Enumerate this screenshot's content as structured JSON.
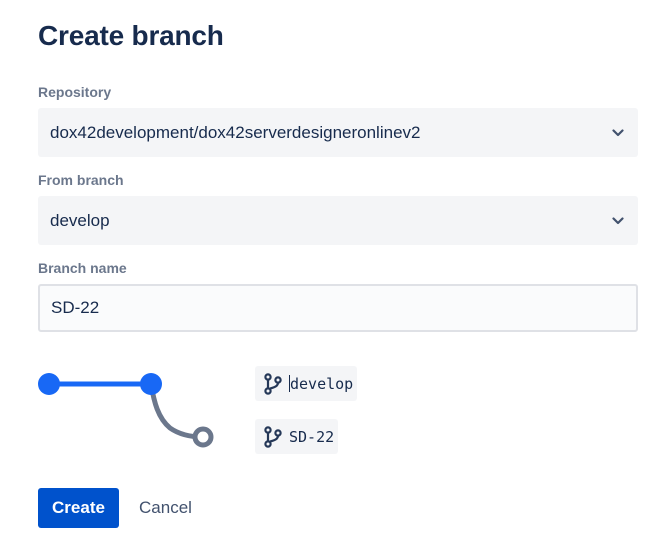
{
  "dialog": {
    "title": "Create branch"
  },
  "repository": {
    "label": "Repository",
    "value": "dox42development/dox42serverdesigneronlinev2"
  },
  "from_branch": {
    "label": "From branch",
    "value": "develop"
  },
  "branch_name": {
    "label": "Branch name",
    "value": "SD-22"
  },
  "preview": {
    "source_branch": "develop",
    "new_branch": "SD-22",
    "icon": "git-branch-icon"
  },
  "actions": {
    "create_label": "Create",
    "cancel_label": "Cancel"
  },
  "colors": {
    "primary": "#0052cc",
    "diagram_blue": "#1868f5",
    "diagram_gray": "#6b778c",
    "text": "#172b4d",
    "label": "#6b778c",
    "field_bg": "#f4f5f7"
  }
}
